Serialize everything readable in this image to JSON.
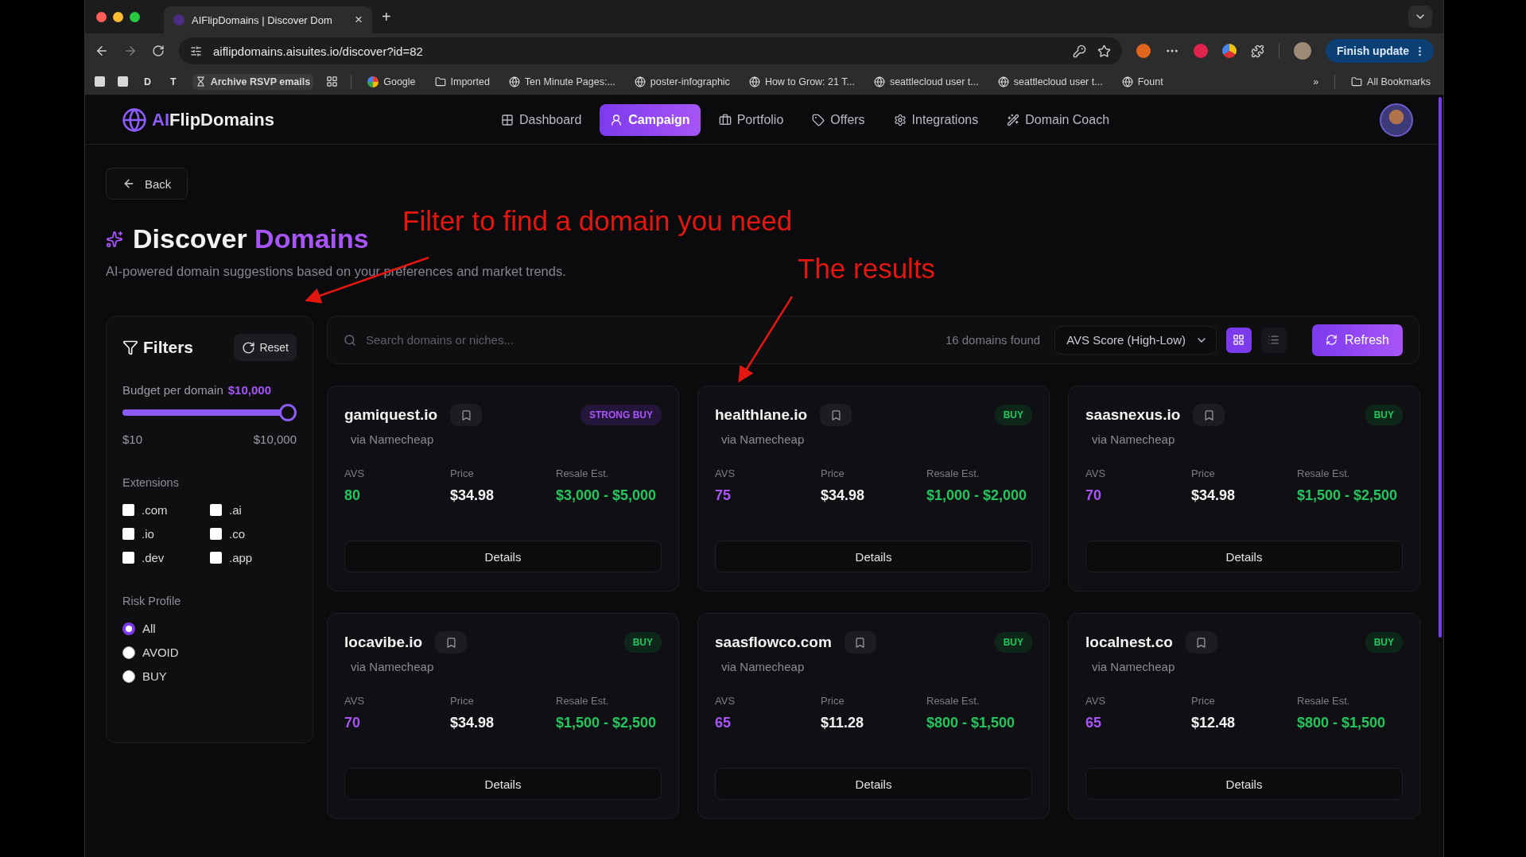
{
  "browser": {
    "tab": {
      "title": "AIFlipDomains | Discover Dom",
      "close": "×"
    },
    "new_tab": "+",
    "url": "aiflipdomains.aisuites.io/discover?id=82",
    "update_button": "Finish update",
    "bookmarks": [
      {
        "kind": "square"
      },
      {
        "kind": "square"
      },
      {
        "kind": "letter",
        "label": "D"
      },
      {
        "kind": "letter",
        "label": "T"
      },
      {
        "kind": "hourglass",
        "label": "Archive RSVP emails"
      },
      {
        "kind": "apps"
      },
      {
        "kind": "google",
        "label": "Google"
      },
      {
        "kind": "folder",
        "label": "Imported"
      },
      {
        "kind": "globe",
        "label": "Ten Minute Pages:..."
      },
      {
        "kind": "globe",
        "label": "poster-infographic"
      },
      {
        "kind": "globe",
        "label": "How to Grow: 21 T..."
      },
      {
        "kind": "globe",
        "label": "seattlecloud user t..."
      },
      {
        "kind": "globe",
        "label": "seattlecloud user t..."
      },
      {
        "kind": "globe",
        "label": "Fount"
      }
    ],
    "more_bookmarks": "»",
    "all_bookmarks": "All Bookmarks"
  },
  "app": {
    "logo": {
      "prefix": "AI",
      "name": "FlipDomains"
    },
    "nav": [
      {
        "label": "Dashboard",
        "selected": false
      },
      {
        "label": "Campaign",
        "selected": true
      },
      {
        "label": "Portfolio",
        "selected": false
      },
      {
        "label": "Offers",
        "selected": false
      },
      {
        "label": "Integrations",
        "selected": false
      },
      {
        "label": "Domain Coach",
        "selected": false
      }
    ]
  },
  "page": {
    "back": "Back",
    "title": "Discover",
    "title_accent": "Domains",
    "subtitle": "AI-powered domain suggestions based on your preferences and market trends."
  },
  "filters": {
    "title": "Filters",
    "reset": "Reset",
    "budget_label": "Budget per domain",
    "budget_value": "$10,000",
    "budget": {
      "level": 1.0
    },
    "budget_min": "$10",
    "budget_max": "$10,000",
    "extensions_label": "Extensions",
    "extensions": [
      {
        "label": ".com",
        "checked": false
      },
      {
        "label": ".ai",
        "checked": false
      },
      {
        "label": ".io",
        "checked": false
      },
      {
        "label": ".co",
        "checked": false
      },
      {
        "label": ".dev",
        "checked": false
      },
      {
        "label": ".app",
        "checked": false
      }
    ],
    "risk_label": "Risk Profile",
    "risk_profiles": [
      {
        "label": "All",
        "selected": true
      },
      {
        "label": "AVOID",
        "selected": false
      },
      {
        "label": "BUY",
        "selected": false
      }
    ]
  },
  "toolbar": {
    "search": {
      "placeholder": "Search domains or niches..."
    },
    "count": "16 domains found",
    "sort": "AVS Score (High-Low)",
    "views": [
      {
        "kind": "grid",
        "selected": true
      },
      {
        "kind": "list",
        "selected": false
      }
    ],
    "refresh": "Refresh"
  },
  "cards": [
    {
      "domain": "gamiquest.io",
      "source": "via Namecheap",
      "badge": {
        "text": "STRONG BUY",
        "kind": "strong_buy"
      },
      "avs_label": "AVS",
      "avs": "80",
      "color": "#22c55e",
      "price_label": "Price",
      "price": "$34.98",
      "resale_label": "Resale Est.",
      "resale": "$3,000 - $5,000",
      "details": "Details"
    },
    {
      "domain": "healthlane.io",
      "source": "via Namecheap",
      "badge": {
        "text": "BUY",
        "kind": "buy"
      },
      "avs_label": "AVS",
      "avs": "75",
      "color": "#a855f7",
      "price_label": "Price",
      "price": "$34.98",
      "resale_label": "Resale Est.",
      "resale": "$1,000 - $2,000",
      "details": "Details"
    },
    {
      "domain": "saasnexus.io",
      "source": "via Namecheap",
      "badge": {
        "text": "BUY",
        "kind": "buy"
      },
      "avs_label": "AVS",
      "avs": "70",
      "color": "#a855f7",
      "price_label": "Price",
      "price": "$34.98",
      "resale_label": "Resale Est.",
      "resale": "$1,500 - $2,500",
      "details": "Details"
    },
    {
      "domain": "locavibe.io",
      "source": "via Namecheap",
      "badge": {
        "text": "BUY",
        "kind": "buy"
      },
      "avs_label": "AVS",
      "avs": "70",
      "color": "#a855f7",
      "price_label": "Price",
      "price": "$34.98",
      "resale_label": "Resale Est.",
      "resale": "$1,500 - $2,500",
      "details": "Details"
    },
    {
      "domain": "saasflowco.com",
      "source": "via Namecheap",
      "badge": {
        "text": "BUY",
        "kind": "buy"
      },
      "avs_label": "AVS",
      "avs": "65",
      "color": "#a855f7",
      "price_label": "Price",
      "price": "$11.28",
      "resale_label": "Resale Est.",
      "resale": "$800 - $1,500",
      "details": "Details"
    },
    {
      "domain": "localnest.co",
      "source": "via Namecheap",
      "badge": {
        "text": "BUY",
        "kind": "buy"
      },
      "avs_label": "AVS",
      "avs": "65",
      "color": "#a855f7",
      "price_label": "Price",
      "price": "$12.48",
      "resale_label": "Resale Est.",
      "resale": "$800 - $1,500",
      "details": "Details"
    }
  ],
  "annotations": [
    {
      "text": "Filter to find a domain you need"
    },
    {
      "text": "The results"
    }
  ]
}
